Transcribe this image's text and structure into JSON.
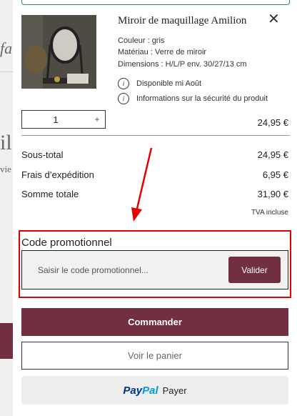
{
  "background": {
    "logo_fragment": "fa",
    "title_fragment": "il",
    "subtitle_fragment": "vie"
  },
  "product": {
    "title": "Miroir de maquillage Amilion",
    "close": "✕",
    "attributes": [
      "Couleur : gris",
      "Matériau : Verre de miroir",
      "Dimensions : H/L/P env. 30/27/13 cm"
    ],
    "info_icon_glyph": "i",
    "availability": "Disponible mi Août",
    "safety_info": "Informations sur la sécurité du produit",
    "quantity": "1",
    "plus": "+",
    "line_price": "24,95 €"
  },
  "summary": {
    "rows": [
      {
        "label": "Sous-total",
        "value": "24,95 €"
      },
      {
        "label": "Frais d’expédition",
        "value": "6,95 €"
      },
      {
        "label": "Somme totale",
        "value": "31,90 €"
      }
    ],
    "tva": "TVA incluse"
  },
  "promo": {
    "label": "Code promotionnel",
    "placeholder": "Saisir le code promotionnel...",
    "validate": "Valider"
  },
  "actions": {
    "order": "Commander",
    "view_cart": "Voir le panier",
    "paypal_pay": "Pay",
    "paypal_pal": "Pal",
    "paypal_payer": "Payer"
  },
  "colors": {
    "accent": "#722f3f",
    "annotation": "#e30000",
    "paypal_dark": "#003087",
    "paypal_light": "#009cde"
  }
}
